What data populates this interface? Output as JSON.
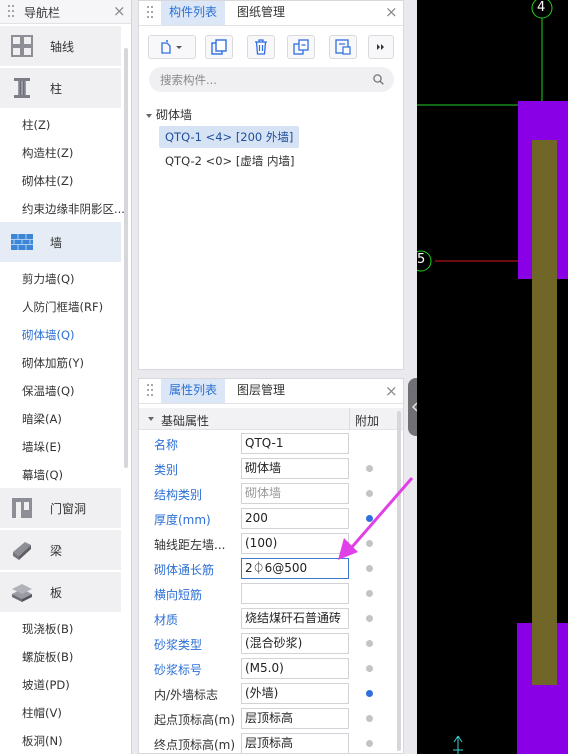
{
  "nav": {
    "title": "导航栏",
    "categories": [
      {
        "label": "轴线",
        "icon": "axis-grid-icon"
      },
      {
        "label": "柱",
        "icon": "column-icon"
      },
      {
        "label": "墙",
        "icon": "brick-wall-icon"
      },
      {
        "label": "门窗洞",
        "icon": "door-window-icon"
      },
      {
        "label": "梁",
        "icon": "beam-icon"
      },
      {
        "label": "板",
        "icon": "slab-icon"
      }
    ],
    "column_items": [
      "柱(Z)",
      "构造柱(Z)",
      "砌体柱(Z)",
      "约束边缘非阴影区..."
    ],
    "wall_items": [
      "剪力墙(Q)",
      "人防门框墙(RF)",
      "砌体墙(Q)",
      "砌体加筋(Y)",
      "保温墙(Q)",
      "暗梁(A)",
      "墙垛(E)",
      "幕墙(Q)"
    ],
    "slab_items": [
      "现浇板(B)",
      "螺旋板(B)",
      "坡道(PD)",
      "柱帽(V)",
      "板洞(N)"
    ]
  },
  "components": {
    "tabs": [
      "构件列表",
      "图纸管理"
    ],
    "toolbar": [
      "new-component-icon",
      "copy-icon",
      "delete-icon",
      "layer-copy-icon",
      "floor-copy-icon",
      "more-icon"
    ],
    "search_placeholder": "搜索构件...",
    "tree_root": "砌体墙",
    "items": [
      "QTQ-1 <4> [200 外墙]",
      "QTQ-2 <0> [虚墙 内墙]"
    ]
  },
  "properties": {
    "tabs": [
      "属性列表",
      "图层管理"
    ],
    "group": "基础属性",
    "extra_header": "附加",
    "rows": [
      {
        "name": "名称",
        "value": "QTQ-1",
        "blue": true,
        "dot": "none"
      },
      {
        "name": "类别",
        "value": "砌体墙",
        "blue": true,
        "dot": "off"
      },
      {
        "name": "结构类别",
        "value": "砌体墙",
        "blue": true,
        "dot": "off",
        "gray": true
      },
      {
        "name": "厚度(mm)",
        "value": "200",
        "blue": true,
        "dot": "on"
      },
      {
        "name": "轴线距左墙...",
        "value": "(100)",
        "blue": false,
        "dot": "off"
      },
      {
        "name": "砌体通长筋",
        "value": "2⏀6@500",
        "blue": true,
        "dot": "off",
        "focus": true
      },
      {
        "name": "横向短筋",
        "value": "",
        "blue": true,
        "dot": "off"
      },
      {
        "name": "材质",
        "value": "烧结煤矸石普通砖",
        "blue": true,
        "dot": "off"
      },
      {
        "name": "砂浆类型",
        "value": "(混合砂浆)",
        "blue": true,
        "dot": "off"
      },
      {
        "name": "砂浆标号",
        "value": "(M5.0)",
        "blue": true,
        "dot": "off"
      },
      {
        "name": "内/外墙标志",
        "value": "(外墙)",
        "blue": false,
        "dot": "on"
      },
      {
        "name": "起点顶标高(m)",
        "value": "层顶标高",
        "blue": false,
        "dot": "off"
      },
      {
        "name": "终点顶标高(m)",
        "value": "层顶标高",
        "blue": false,
        "dot": "off"
      }
    ]
  },
  "canvas": {
    "axis_labels": [
      "4",
      "5"
    ],
    "colors": {
      "background": "#000000",
      "wall_purple": "#8a00e6",
      "wall_olive": "#6f6627",
      "axis_green": "#1fd01f",
      "axis_red": "#d81818",
      "annotation_arrow": "#e040e8"
    }
  }
}
